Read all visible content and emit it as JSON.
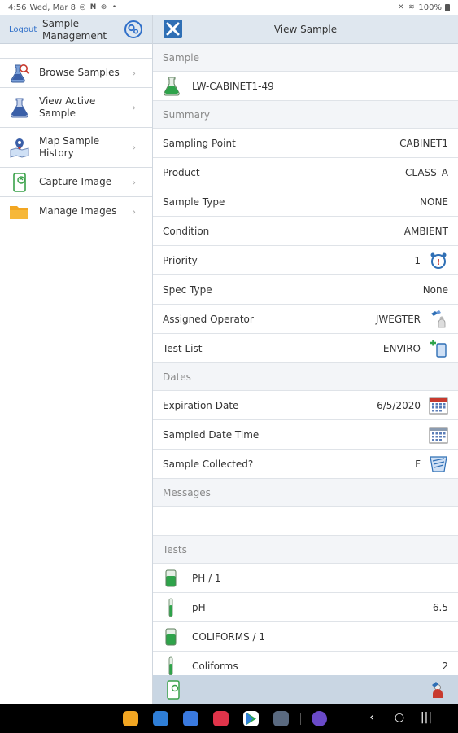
{
  "status_bar": {
    "time": "4:56",
    "date": "Wed, Mar 8",
    "battery": "100%"
  },
  "left": {
    "logout_label": "Logout",
    "title": "Sample Management",
    "menu": [
      {
        "label": "Browse Samples",
        "icon": "flask-search-icon"
      },
      {
        "label": "View Active Sample",
        "icon": "flask-icon"
      },
      {
        "label": "Map Sample History",
        "icon": "map-pin-icon"
      },
      {
        "label": "Capture Image",
        "icon": "phone-camera-icon"
      },
      {
        "label": "Manage Images",
        "icon": "folder-icon"
      }
    ]
  },
  "right": {
    "title": "View Sample",
    "sections": {
      "sample": "Sample",
      "summary": "Summary",
      "dates": "Dates",
      "messages": "Messages",
      "tests": "Tests"
    },
    "sample_id": "LW-CABINET1-49",
    "summary": [
      {
        "label": "Sampling Point",
        "value": "CABINET1"
      },
      {
        "label": "Product",
        "value": "CLASS_A"
      },
      {
        "label": "Sample Type",
        "value": "NONE"
      },
      {
        "label": "Condition",
        "value": "AMBIENT"
      },
      {
        "label": "Priority",
        "value": "1"
      },
      {
        "label": "Spec Type",
        "value": "None"
      },
      {
        "label": "Assigned Operator",
        "value": "JWEGTER"
      },
      {
        "label": "Test List",
        "value": "ENVIRO"
      }
    ],
    "dates": [
      {
        "label": "Expiration Date",
        "value": "6/5/2020"
      },
      {
        "label": "Sampled Date Time",
        "value": ""
      },
      {
        "label": "Sample Collected?",
        "value": "F"
      }
    ],
    "tests": [
      {
        "label": "PH / 1",
        "value": "",
        "kind": "beaker"
      },
      {
        "label": "pH",
        "value": "6.5",
        "kind": "tube"
      },
      {
        "label": "COLIFORMS / 1",
        "value": "",
        "kind": "beaker"
      },
      {
        "label": "Coliforms",
        "value": "2",
        "kind": "tube"
      }
    ]
  },
  "colors": {
    "header": "#dfe7ef",
    "accent": "#2f6fb5",
    "section_bg": "#f3f5f8",
    "flask_green": "#2ea34a"
  }
}
